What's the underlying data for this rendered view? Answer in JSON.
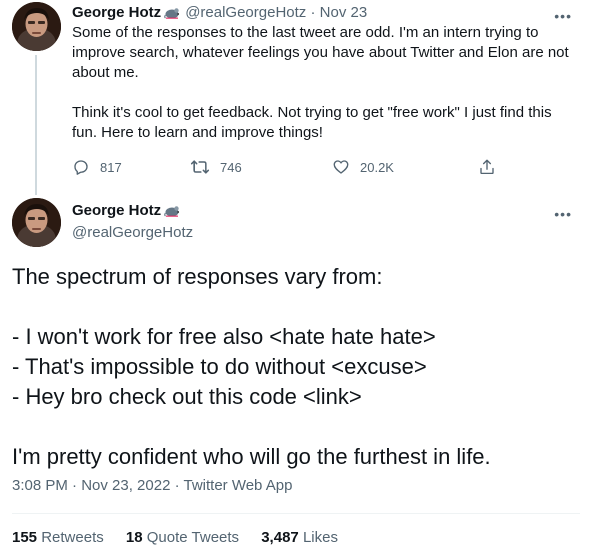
{
  "tweet1": {
    "author_name": "George Hotz",
    "handle": "@realGeorgeHotz",
    "separator": "·",
    "date": "Nov 23",
    "more_icon": "more-horizontal-icon",
    "paragraph1": "Some of the responses to the last tweet are odd. I'm an intern trying to improve search, whatever feelings you have about Twitter and Elon are not about me.",
    "paragraph2": "Think it's cool to get feedback. Not trying to get \"free work\" I just find this fun. Here to learn and improve things!",
    "replies": "817",
    "retweets": "746",
    "likes": "20.2K"
  },
  "tweet2": {
    "author_name": "George Hotz",
    "handle": "@realGeorgeHotz",
    "lines": [
      "The spectrum of responses vary from:",
      "",
      "- I won't work for free also <hate hate hate>",
      "- That's impossible to do without <excuse>",
      "- Hey bro check out this code <link>",
      "",
      "I'm pretty confident who will go the furthest in life."
    ],
    "timestamp": "3:08 PM · Nov 23, 2022 · Twitter Web App",
    "stats": {
      "retweets_count": "155",
      "retweets_label": "Retweets",
      "quotes_count": "18",
      "quotes_label": "Quote Tweets",
      "likes_count": "3,487",
      "likes_label": "Likes"
    }
  },
  "colors": {
    "text": "#0f1419",
    "secondary": "#536471",
    "thread_line": "#cfd9de",
    "divider": "#eff3f4"
  }
}
